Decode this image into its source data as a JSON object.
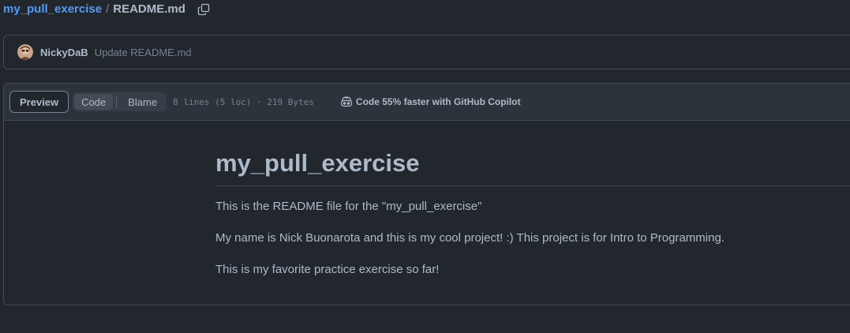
{
  "breadcrumb": {
    "repo": "my_pull_exercise",
    "separator": "/",
    "file": "README.md",
    "copy_icon": "copy-icon"
  },
  "commit": {
    "author": "NickyDaB",
    "message": "Update README.md"
  },
  "file_header": {
    "preview_label": "Preview",
    "code_label": "Code",
    "blame_label": "Blame",
    "meta": "8 lines (5 loc) · 219 Bytes",
    "copilot_text": "Code 55% faster with GitHub Copilot",
    "copilot_icon": "copilot-icon"
  },
  "readme": {
    "heading": "my_pull_exercise",
    "paragraphs": [
      "This is the README file for the \"my_pull_exercise\"",
      "My name is Nick Buonarota and this is my cool project! :) This project is for Intro to Programming.",
      "This is my favorite practice exercise so far!"
    ]
  },
  "colors": {
    "background": "#22272e",
    "header_background": "#2d333b",
    "border": "#444c56",
    "link": "#539bf5",
    "text": "#adbac7",
    "muted": "#768390"
  }
}
